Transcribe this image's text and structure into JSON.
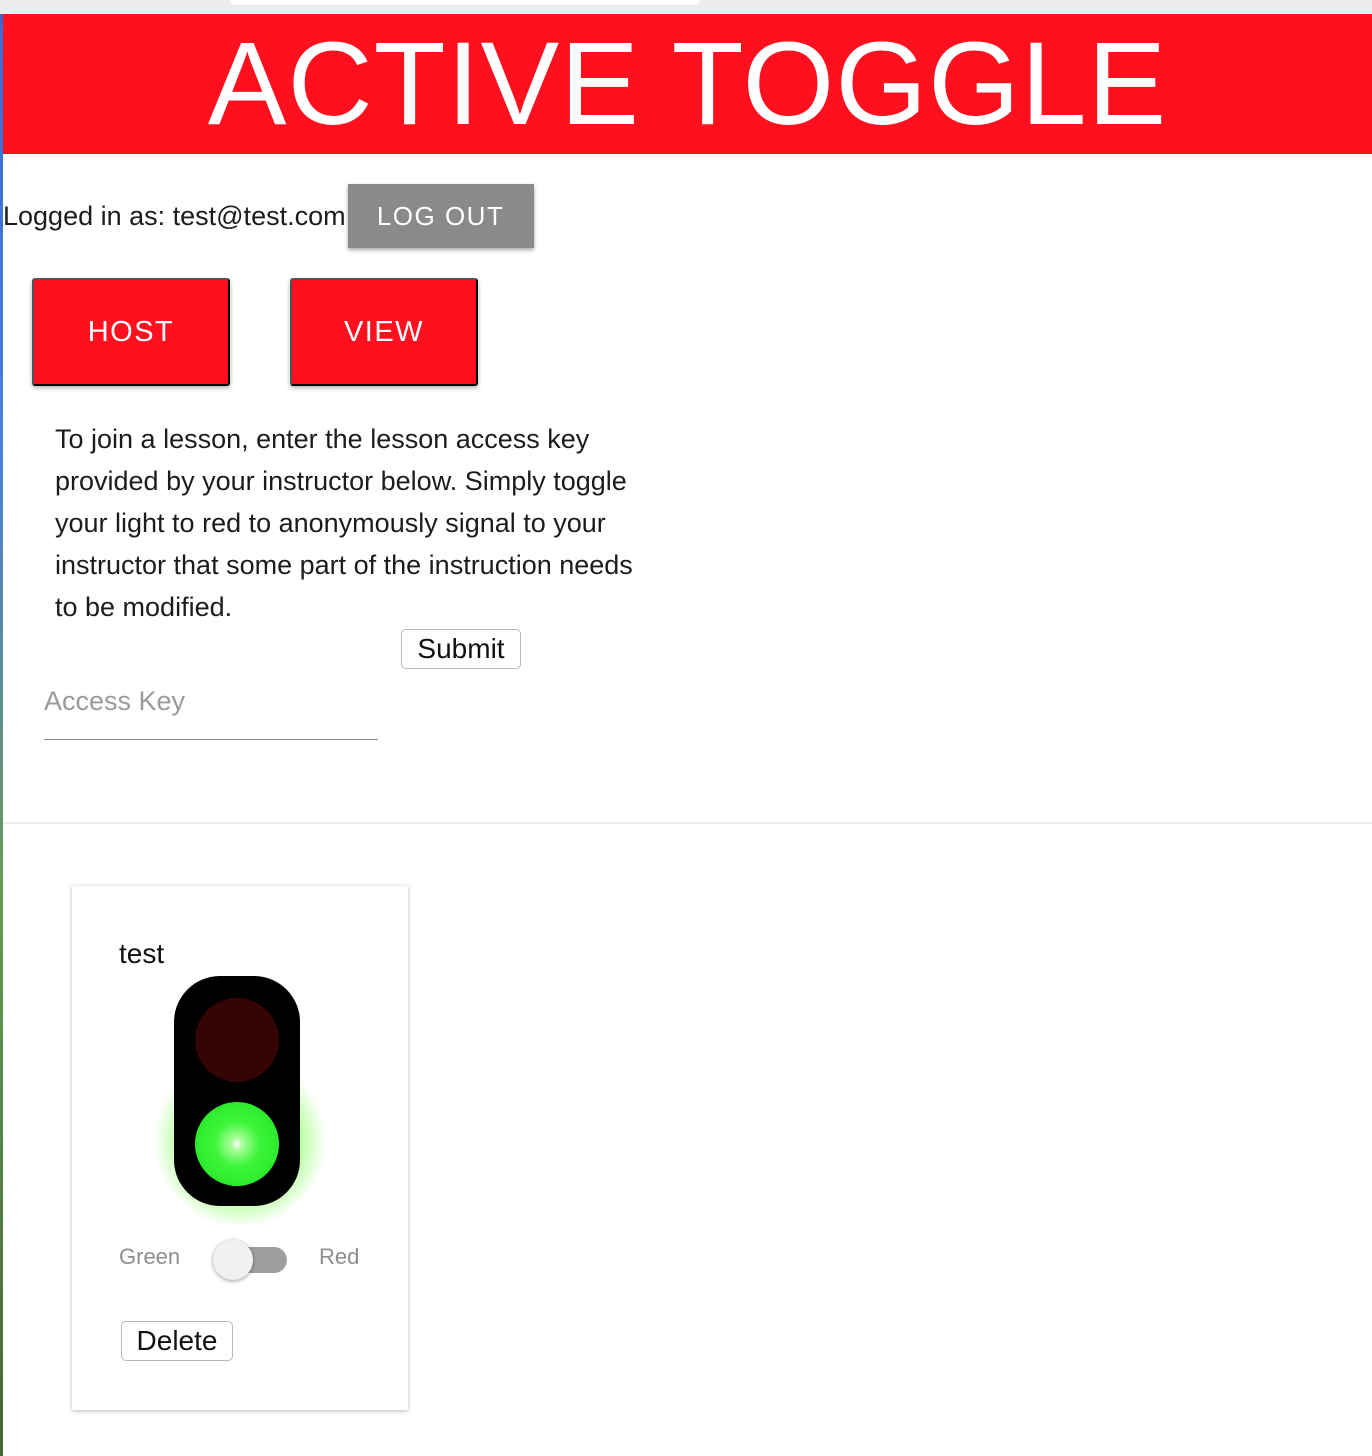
{
  "header": {
    "title": "ACTIVE TOGGLE",
    "background": "#fe101e"
  },
  "account": {
    "logged_in_text": "Logged in as: test@test.com",
    "logout_label": "LOG OUT"
  },
  "nav": {
    "host_label": "HOST",
    "view_label": "VIEW"
  },
  "join": {
    "instructions": "To join a lesson, enter the lesson access key provided by your instructor below. Simply toggle your light to red to anonymously signal to your instructor that some part of the instruction needs to be modified.",
    "submit_label": "Submit",
    "access_key_value": "",
    "access_key_placeholder": "Access Key"
  },
  "lessons": [
    {
      "name": "test",
      "light_state": "green",
      "toggle_left_label": "Green",
      "toggle_right_label": "Red",
      "delete_label": "Delete"
    }
  ],
  "colors": {
    "accent_red": "#fe101e",
    "logout_gray": "#8a8a8a",
    "light_green": "#3df53a",
    "light_red_off": "#350404"
  }
}
